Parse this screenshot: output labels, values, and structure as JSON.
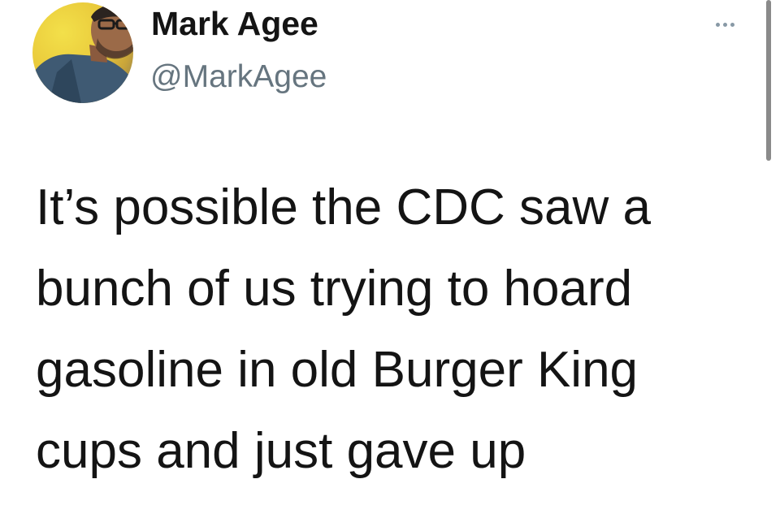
{
  "user": {
    "display_name": "Mark Agee",
    "handle": "@MarkAgee",
    "avatar_icon": "profile-photo"
  },
  "more_menu": {
    "icon": "more-horizontal-icon"
  },
  "tweet": {
    "lines": [
      "It’s possible the CDC saw a",
      "bunch of us trying to hoard",
      "gasoline in old Burger King",
      "cups and just gave up"
    ]
  },
  "colors": {
    "text": "#141414",
    "handle": "#66757f",
    "dots": "#8899a6",
    "avatar_bg": "#e9c93a"
  }
}
